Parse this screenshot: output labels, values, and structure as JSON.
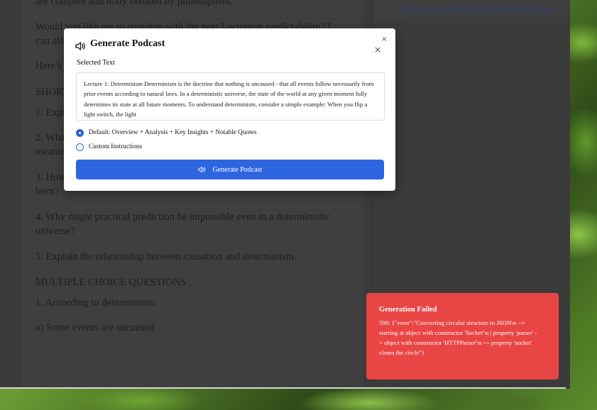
{
  "document": {
    "paragraphs": [
      "are complex and hotly debated by philosophers.",
      "Would you like me to continue with the next Lectureon predictability? I can also ad",
      "Here's",
      "SHORT",
      "1. Expla",
      "2. What",
      "meanin",
      "3. How",
      "born?",
      "4. Why might practical prediction be impossible even in a deterministic universe?",
      "5. Explain the relationship between causation and determinism.",
      "MULTIPLE CHOICE QUESTIONS",
      "1. According to determinism:",
      "a) Some events are uncaused"
    ]
  },
  "right_panel": {
    "hint": "Start by asking a question or highlighting text from the"
  },
  "modal": {
    "title": "Generate Podcast",
    "close_a": "×",
    "close_b": "×",
    "selected_label": "Selected Text",
    "selected_text": "Lecture 1: Determinism  Determinism is the doctrine that nothing is uncaused - that all events follow necessarily from prior events according to natural laws. In a deterministic universe, the state of the world at any given moment fully determines its state at all future moments.  To understand determinism, consider a simple example: When you flip a light switch, the light",
    "options": [
      {
        "label": "Default: Overview + Analysis + Key Insights + Notable Quotes",
        "checked": true
      },
      {
        "label": "Custom Instructions",
        "checked": false
      }
    ],
    "button_label": "Generate Podcast",
    "title_icon": "speaker-icon",
    "button_icon": "speaker-icon"
  },
  "toast": {
    "title": "Generation Failed",
    "message": "500: {\"error\":\"Converting circular structure to JSON\\n --> starting at object with constructor 'Socket'\\n | property 'parser' -> object with constructor 'HTTPParser'\\n --- property 'socket' closes the circle\"}"
  },
  "colors": {
    "accent": "#2d65e0",
    "error": "#e94545"
  }
}
